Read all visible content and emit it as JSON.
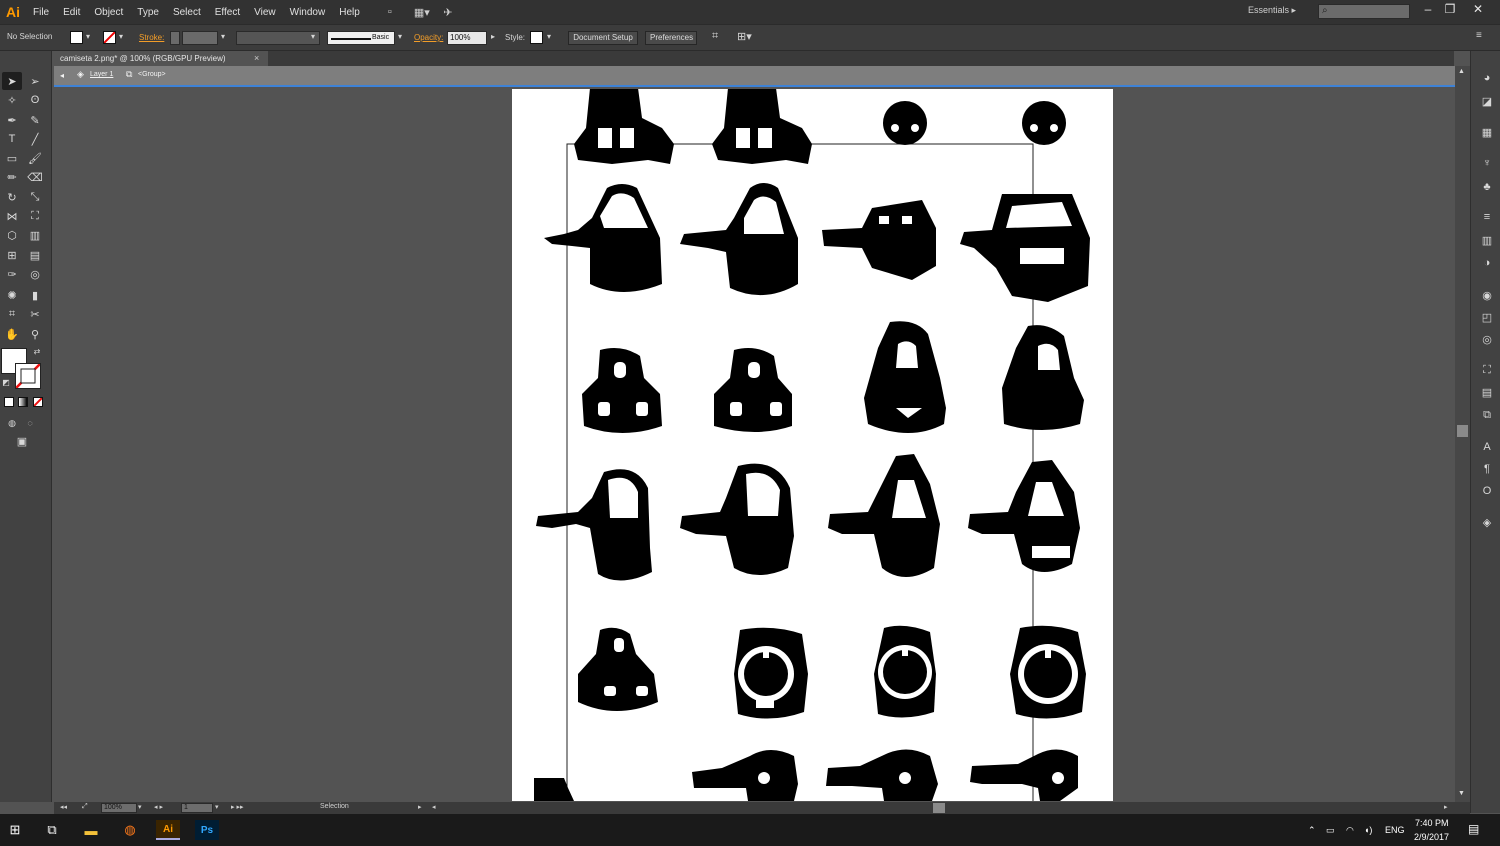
{
  "menubar": {
    "logo": "Ai",
    "items": [
      "File",
      "Edit",
      "Object",
      "Type",
      "Select",
      "Effect",
      "View",
      "Window",
      "Help"
    ],
    "workspace": "Essentials",
    "search_placeholder": "",
    "colors": {
      "logo": "#ff9a00"
    }
  },
  "controlbar": {
    "selection_text": "No Selection",
    "stroke_label": "Stroke:",
    "brush_label": "Basic",
    "opacity_label": "Opacity:",
    "opacity_value": "100%",
    "style_label": "Style:",
    "document_setup": "Document Setup",
    "preferences": "Preferences"
  },
  "document": {
    "tab_title": "camiseta 2.png* @ 100% (RGB/GPU Preview)",
    "tab_close": "×"
  },
  "isolation": {
    "layer": "Layer 1",
    "group": "<Group>"
  },
  "statusbar": {
    "zoom": "100%",
    "page": "1",
    "tool": "Selection"
  },
  "taskbar": {
    "tray_lang": "ENG",
    "time": "7:40 PM",
    "date": "2/9/2017"
  }
}
